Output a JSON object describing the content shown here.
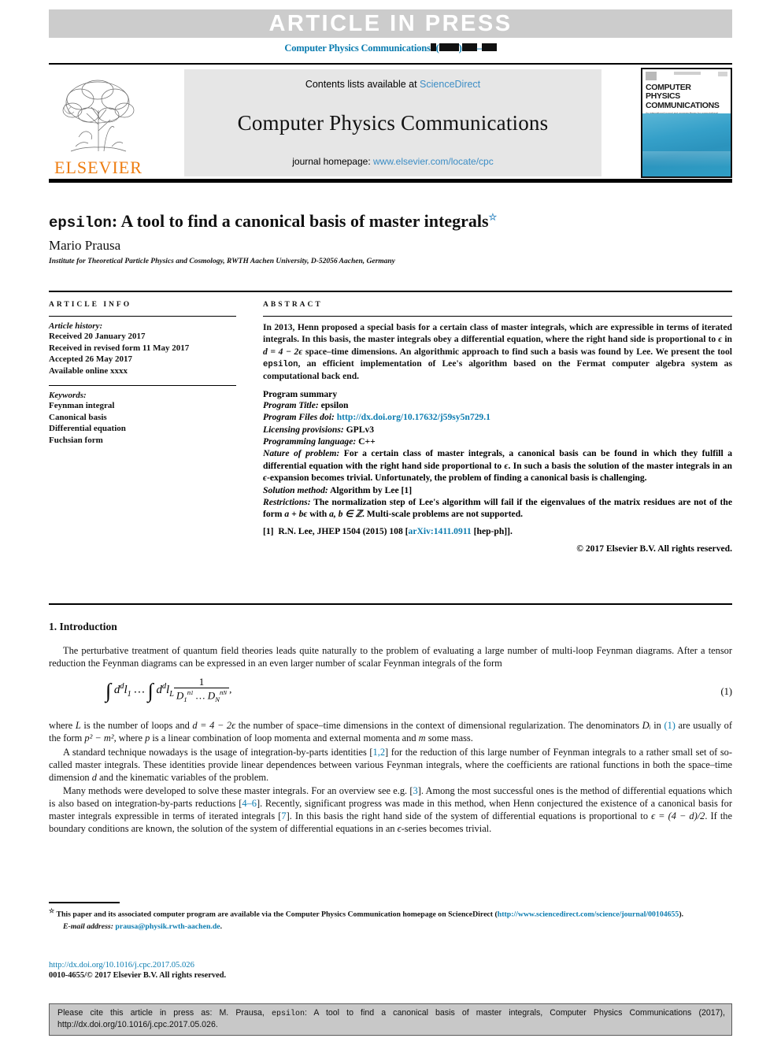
{
  "banner": {
    "text": "ARTICLE IN PRESS",
    "bg": "#cccccc",
    "fg": "#ffffff"
  },
  "volume_line": {
    "journal": "Computer Physics Communications",
    "open_paren": "(",
    "close_paren": ")",
    "dash": "–"
  },
  "masthead": {
    "contents_prefix": "Contents lists available at ",
    "sciencedirect": "ScienceDirect",
    "journal_name": "Computer Physics Communications",
    "homepage_prefix": "journal homepage: ",
    "homepage_url": "www.elsevier.com/locate/cpc",
    "elsevier_wordmark": "ELSEVIER",
    "cover_title_line1": "COMPUTER PHYSICS",
    "cover_title_line2": "COMMUNICATIONS",
    "cover_subtitle": "An international journal and program library for computational physics and physical chemistry",
    "link_color": "#3c8dc5"
  },
  "title_block": {
    "title_mono": "epsilon",
    "title_rest": ": A tool to find a canonical basis of master integrals",
    "footnote_marker": "☆",
    "author": "Mario Prausa",
    "affiliation": "Institute for Theoretical Particle Physics and Cosmology, RWTH Aachen University, D-52056 Aachen, Germany"
  },
  "article_info": {
    "heading": "ARTICLE INFO",
    "history_label": "Article history:",
    "history": [
      "Received 20 January 2017",
      "Received in revised form 11 May 2017",
      "Accepted 26 May 2017",
      "Available online xxxx"
    ],
    "keywords_label": "Keywords:",
    "keywords": [
      "Feynman integral",
      "Canonical basis",
      "Differential equation",
      "Fuchsian form"
    ]
  },
  "abstract": {
    "heading": "ABSTRACT",
    "body_1": "In 2013, Henn proposed a special basis for a certain class of master integrals, which are expressible in terms of iterated integrals. In this basis, the master integrals obey a differential equation, where the right hand side is proportional to ",
    "body_eps_1": "ϵ",
    "body_2": " in ",
    "body_math": "d = 4 − 2ϵ",
    "body_3": " space–time dimensions. An algorithmic approach to find such a basis was found by Lee. We present the tool ",
    "body_tool": "epsilon",
    "body_4": ", an efficient implementation of Lee's algorithm based on the Fermat computer algebra system as computational back end."
  },
  "program_summary": {
    "title": "Program summary",
    "program_title_label": "Program Title:",
    "program_title_value": "epsilon",
    "files_doi_label": "Program Files doi:",
    "files_doi_value": "http://dx.doi.org/10.17632/j59sy5n729.1",
    "licensing_label": "Licensing provisions:",
    "licensing_value": "GPLv3",
    "language_label": "Programming language:",
    "language_value": "C++",
    "nature_label": "Nature of problem:",
    "nature_value_a": "For a certain class of master integrals, a canonical basis can be found in which they fulfill a differential equation with the right hand side proportional to ",
    "nature_eps": "ϵ",
    "nature_value_b": ". In such a basis the solution of the master integrals in an ",
    "nature_eps2": "ϵ",
    "nature_value_c": "-expansion becomes trivial. Unfortunately, the problem of finding a canonical basis is challenging.",
    "solution_label": "Solution method:",
    "solution_value": "Algorithm by Lee [1]",
    "restrictions_label": "Restrictions:",
    "restrictions_value_a": "The normalization step of Lee's algorithm will fail if the eigenvalues of the matrix residues are not of the form ",
    "restrictions_math": "a + bϵ",
    "restrictions_value_b": " with ",
    "restrictions_math2": "a, b ∈ ℤ",
    "restrictions_value_c": ". Multi-scale problems are not supported.",
    "reference_num": "[1]",
    "reference_text_a": "R.N. Lee, JHEP ",
    "reference_bold": "1504",
    "reference_text_b": " (2015) 108 [",
    "reference_link": "arXiv:1411.0911",
    "reference_text_c": " [hep-ph]].",
    "copyright": "© 2017 Elsevier B.V. All rights reserved."
  },
  "introduction": {
    "heading": "1. Introduction",
    "p1": "The perturbative treatment of quantum field theories leads quite naturally to the problem of evaluating a large number of multi-loop Feynman diagrams. After a tensor reduction the Feynman diagrams can be expressed in an even larger number of scalar Feynman integrals of the form",
    "equation_number": "(1)",
    "equation_text": "∫ d^d l₁ … ∫ d^d l_L  1/(D₁^{n₁} … D_N^{n_N}) ,",
    "p2_a": "where ",
    "p2_L": "L",
    "p2_b": " is the number of loops and ",
    "p2_math": "d = 4 − 2ϵ",
    "p2_c": " the number of space–time dimensions in the context of dimensional regularization. The denominators ",
    "p2_D": "Dᵢ",
    "p2_d": " in ",
    "p2_ref1": "(1)",
    "p2_e": " are usually of the form ",
    "p2_math2": "p² − m²",
    "p2_f": ", where ",
    "p2_p": "p",
    "p2_g": " is a linear combination of loop momenta and external momenta and ",
    "p2_m": "m",
    "p2_h": " some mass.",
    "p3_a": "A standard technique nowadays is the usage of integration-by-parts identities [",
    "p3_ref": "1,2",
    "p3_b": "] for the reduction of this large number of Feynman integrals to a rather small set of so-called master integrals. These identities provide linear dependences between various Feynman integrals, where the coefficients are rational functions in both the space–time dimension ",
    "p3_d": "d",
    "p3_c": " and the kinematic variables of the problem.",
    "p4_a": "Many methods were developed to solve these master integrals. For an overview see e.g. [",
    "p4_ref3": "3",
    "p4_b": "]. Among the most successful ones is the method of differential equations which is also based on integration-by-parts reductions [",
    "p4_ref46": "4–6",
    "p4_c": "]. Recently, significant progress was made in this method, when Henn conjectured the existence of a canonical basis for master integrals expressible in terms of iterated integrals [",
    "p4_ref7": "7",
    "p4_d": "]. In this basis the right hand side of the system of differential equations is proportional to ",
    "p4_math": "ϵ = (4 − d)/2",
    "p4_e": ". If the boundary conditions are known, the solution of the system of differential equations in an ",
    "p4_eps": "ϵ",
    "p4_f": "-series becomes trivial."
  },
  "footnotes": {
    "star": "☆",
    "fn_text_a": " This paper and its associated computer program are available via the Computer Physics Communication homepage on ScienceDirect (",
    "fn_link": "http://www.sciencedirect.com/science/journal/00104655",
    "fn_text_b": ").",
    "email_label": "E-mail address:",
    "email_value": "prausa@physik.rwth-aachen.de",
    "email_period": "."
  },
  "doi_footer": {
    "doi": "http://dx.doi.org/10.1016/j.cpc.2017.05.026",
    "issn": "0010-4655/© 2017 Elsevier B.V. All rights reserved."
  },
  "cite_box": {
    "prefix": "Please cite this article in press as: M. Prausa, ",
    "mono": "epsilon",
    "suffix": ": A tool to find a canonical basis of master integrals, Computer Physics Communications (2017), http://dx.doi.org/10.1016/j.cpc.2017.05.026."
  },
  "colors": {
    "link_blue": "#0b7cb0",
    "sciencedirect_blue": "#3c8dc5",
    "elsevier_orange": "#ee7d11",
    "banner_grey": "#cccccc",
    "cite_grey": "#c8c8c8"
  }
}
